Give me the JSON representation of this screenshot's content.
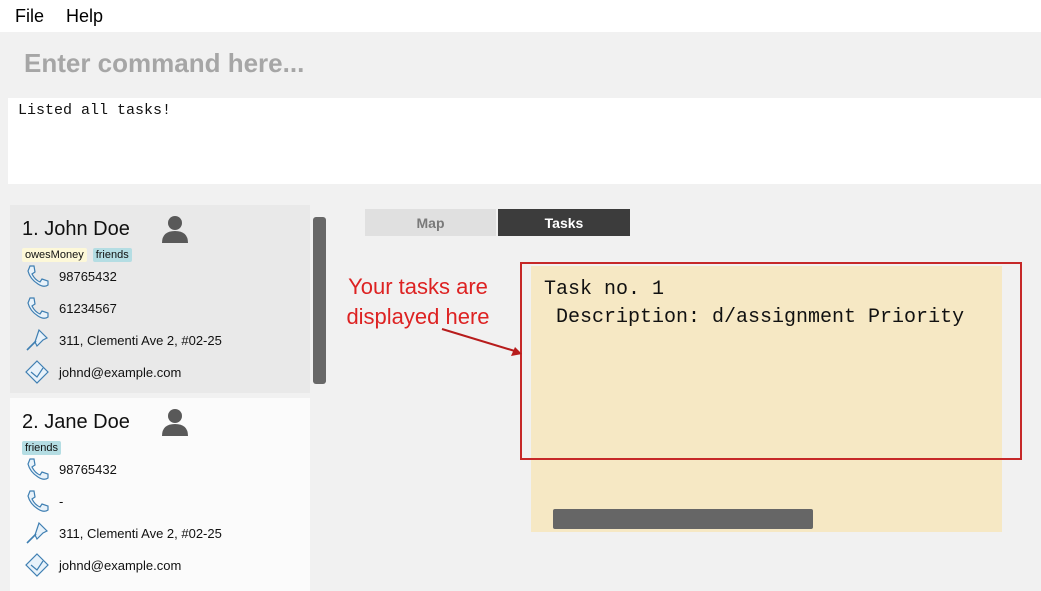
{
  "menu": {
    "file": "File",
    "help": "Help"
  },
  "command": {
    "placeholder": "Enter command here..."
  },
  "result": {
    "text": "Listed all tasks!"
  },
  "people": [
    {
      "name": "1.  John Doe",
      "tags": [
        "owesMoney",
        "friends"
      ],
      "phone": "98765432",
      "phone2": "61234567",
      "address": "311, Clementi Ave 2, #02-25",
      "email": "johnd@example.com"
    },
    {
      "name": "2.  Jane Doe",
      "tags": [
        "friends"
      ],
      "phone": "98765432",
      "phone2": "-",
      "address": "311, Clementi Ave 2, #02-25",
      "email": "johnd@example.com"
    }
  ],
  "tabs": {
    "map": "Map",
    "tasks": "Tasks"
  },
  "task_panel": {
    "line1": "Task no. 1",
    "line2": " Description: d/assignment Priority"
  },
  "annotation": {
    "text": "Your tasks are displayed here",
    "color": "#d22222"
  },
  "icons": [
    "person-icon",
    "phone-icon",
    "address-pin-icon",
    "email-icon"
  ]
}
